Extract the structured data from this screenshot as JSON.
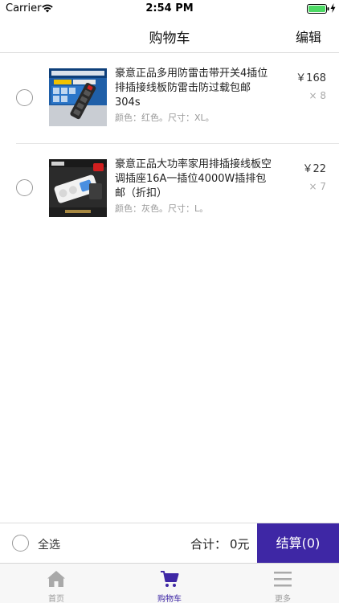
{
  "status_bar": {
    "carrier": "Carrier",
    "time": "2:54 PM",
    "battery_color": "#4cd964"
  },
  "nav": {
    "title": "购物车",
    "edit": "编辑"
  },
  "cart_items": [
    {
      "title": "豪意正品多用防雷击带开关4插位排插接线板防雷击防过载包邮304s",
      "spec": "颜色：红色。尺寸：XL。",
      "price": "￥168",
      "quantity": "× 8",
      "image_icon": "power-strip-blue-product-image"
    },
    {
      "title": "豪意正品大功率家用排插接线板空调插座16A一插位4000W插排包邮（折扣）",
      "spec": "颜色：灰色。尺寸：L。",
      "price": "￥22",
      "quantity": "× 7",
      "image_icon": "power-strip-dark-product-image"
    }
  ],
  "checkout": {
    "select_all": "全选",
    "total_label": "合计：",
    "total_value": "0元",
    "checkout_button": "结算(0)",
    "accent_color": "#3e27a5"
  },
  "tabs": [
    {
      "label": "首页",
      "icon": "home-icon",
      "active": false
    },
    {
      "label": "购物车",
      "icon": "cart-icon",
      "active": true
    },
    {
      "label": "更多",
      "icon": "menu-icon",
      "active": false
    }
  ]
}
